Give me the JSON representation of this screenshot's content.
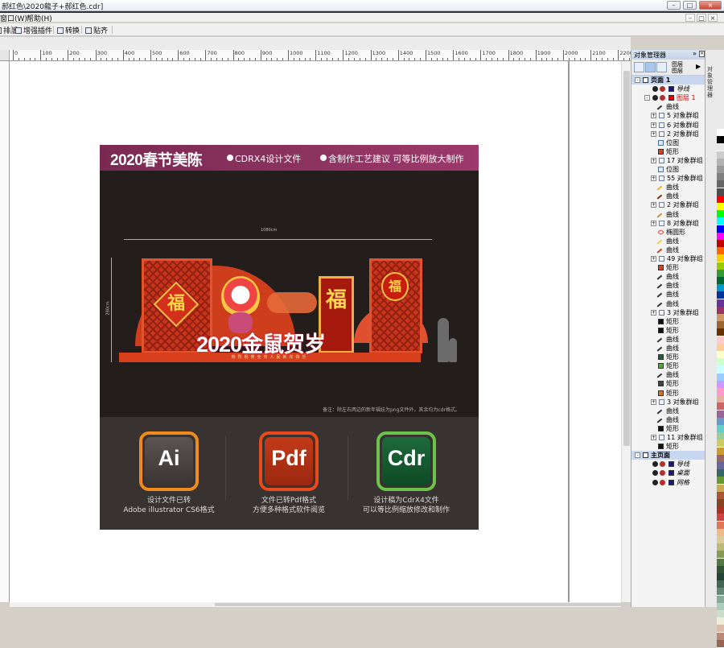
{
  "window": {
    "title": "郝红色\\2020龍子+郝红色.cdr]",
    "min": "–",
    "max": "□",
    "close": "×"
  },
  "menu": {
    "items": [
      "窗口(W)",
      "帮助(H)"
    ],
    "mdi": [
      "–",
      "□",
      "×"
    ]
  },
  "toolbar": {
    "items": [
      "排版",
      "增强插件",
      "转换",
      "贴齐"
    ]
  },
  "ruler": {
    "marks": [
      "0",
      "100",
      "200",
      "300",
      "400",
      "500",
      "600",
      "700",
      "800",
      "900",
      "1000",
      "1100",
      "1200",
      "1300",
      "1400",
      "1500",
      "1600",
      "1700",
      "1800",
      "1900",
      "2000",
      "2100",
      "2200"
    ],
    "unit": "毫米"
  },
  "design": {
    "header_big": "2020春节美陈",
    "header_sub1": "CDRX4设计文件",
    "header_sub2": "含制作工艺建议 可等比例放大制作",
    "dimension": "1080cm",
    "height_dim": "280cm",
    "fu1": "福",
    "fu2": "福",
    "fu3": "福",
    "slogan": "2020金鼠贺岁",
    "floor_text": "热烈祝贺全市人民新年快乐",
    "note": "备注：除左右两边的新年福娃为png文件外，其余均为cdr格式。",
    "formats": [
      {
        "label": "Ai",
        "cap1": "设计文件已转",
        "cap2": "Adobe illustrator CS6格式"
      },
      {
        "label": "Pdf",
        "cap1": "文件已转Pdf格式",
        "cap2": "方便多种格式软件阅览"
      },
      {
        "label": "Cdr",
        "cap1": "设计稿为CdrX4文件",
        "cap2": "可以等比例缩放修改和制作"
      }
    ]
  },
  "docker": {
    "title": "对象管理器",
    "tool_labels": [
      "图层",
      "图层"
    ],
    "side_tab": "对象管理器",
    "tree": [
      {
        "label": "页面 1",
        "level": 0,
        "exp": "-",
        "kind": "page",
        "bold": true
      },
      {
        "label": "导线",
        "level": 1,
        "kind": "layer-guide",
        "italic": true
      },
      {
        "label": "图层 1",
        "level": 1,
        "exp": "-",
        "kind": "layer",
        "red": true
      },
      {
        "label": "曲线",
        "level": 2,
        "kind": "curve"
      },
      {
        "label": "5 对象群组",
        "level": 2,
        "exp": "+",
        "kind": "group"
      },
      {
        "label": "6 对象群组",
        "level": 2,
        "exp": "+",
        "kind": "group"
      },
      {
        "label": "2 对象群组",
        "level": 2,
        "exp": "+",
        "kind": "group"
      },
      {
        "label": "位图",
        "level": 2,
        "kind": "bitmap"
      },
      {
        "label": "矩形",
        "level": 2,
        "kind": "rect",
        "color": "#e0401c"
      },
      {
        "label": "17 对象群组",
        "level": 2,
        "exp": "+",
        "kind": "group"
      },
      {
        "label": "位图",
        "level": 2,
        "kind": "bitmap"
      },
      {
        "label": "55 对象群组",
        "level": 2,
        "exp": "+",
        "kind": "group"
      },
      {
        "label": "曲线",
        "level": 2,
        "kind": "curve",
        "color": "#f0b020"
      },
      {
        "label": "曲线",
        "level": 2,
        "kind": "curve",
        "color": "#8a2a10"
      },
      {
        "label": "2 对象群组",
        "level": 2,
        "exp": "+",
        "kind": "group"
      },
      {
        "label": "曲线",
        "level": 2,
        "kind": "curve",
        "color": "#c89030"
      },
      {
        "label": "8 对象群组",
        "level": 2,
        "exp": "+",
        "kind": "group"
      },
      {
        "label": "椭圆形",
        "level": 2,
        "kind": "ellipse"
      },
      {
        "label": "曲线",
        "level": 2,
        "kind": "curve",
        "color": "#f0d040"
      },
      {
        "label": "曲线",
        "level": 2,
        "kind": "curve",
        "color": "#d04010"
      },
      {
        "label": "49 对象群组",
        "level": 2,
        "exp": "+",
        "kind": "group"
      },
      {
        "label": "矩形",
        "level": 2,
        "kind": "rect",
        "color": "#e0401c"
      },
      {
        "label": "曲线",
        "level": 2,
        "kind": "curve"
      },
      {
        "label": "曲线",
        "level": 2,
        "kind": "curve"
      },
      {
        "label": "曲线",
        "level": 2,
        "kind": "curve"
      },
      {
        "label": "曲线",
        "level": 2,
        "kind": "curve"
      },
      {
        "label": "3 对象群组",
        "level": 2,
        "exp": "+",
        "kind": "group"
      },
      {
        "label": "矩形",
        "level": 2,
        "kind": "rect",
        "color": "#111111"
      },
      {
        "label": "矩形",
        "level": 2,
        "kind": "rect",
        "color": "#111111"
      },
      {
        "label": "曲线",
        "level": 2,
        "kind": "curve"
      },
      {
        "label": "曲线",
        "level": 2,
        "kind": "curve"
      },
      {
        "label": "矩形",
        "level": 2,
        "kind": "rect",
        "color": "#116633"
      },
      {
        "label": "矩形",
        "level": 2,
        "kind": "rect",
        "color": "#55aa33"
      },
      {
        "label": "曲线",
        "level": 2,
        "kind": "curve"
      },
      {
        "label": "矩形",
        "level": 2,
        "kind": "rect",
        "color": "#444444"
      },
      {
        "label": "矩形",
        "level": 2,
        "kind": "rect",
        "color": "#e07010"
      },
      {
        "label": "3 对象群组",
        "level": 2,
        "exp": "+",
        "kind": "group"
      },
      {
        "label": "曲线",
        "level": 2,
        "kind": "curve"
      },
      {
        "label": "曲线",
        "level": 2,
        "kind": "curve"
      },
      {
        "label": "矩形",
        "level": 2,
        "kind": "rect",
        "color": "#111111"
      },
      {
        "label": "11 对象群组",
        "level": 2,
        "exp": "+",
        "kind": "group"
      },
      {
        "label": "矩形",
        "level": 2,
        "kind": "rect",
        "color": "#111111"
      },
      {
        "label": "主页面",
        "level": 0,
        "exp": "-",
        "kind": "page",
        "bold": true
      },
      {
        "label": "导线",
        "level": 1,
        "kind": "layer-guide",
        "italic": true
      },
      {
        "label": "桌面",
        "level": 1,
        "kind": "layer-desk",
        "italic": true
      },
      {
        "label": "网格",
        "level": 1,
        "kind": "layer-grid",
        "italic": true
      }
    ]
  },
  "palette": [
    "#ffffff",
    "#000000",
    "#e6e6e6",
    "#cccccc",
    "#b3b3b3",
    "#999999",
    "#808080",
    "#666666",
    "#4d4d4d",
    "#ff0000",
    "#ffff00",
    "#00ff00",
    "#00ffff",
    "#0000ff",
    "#ff00ff",
    "#c00000",
    "#ff6600",
    "#ffcc00",
    "#99cc00",
    "#339933",
    "#006633",
    "#0099cc",
    "#003399",
    "#663399",
    "#993366",
    "#cc9966",
    "#996633",
    "#663300",
    "#ffcccc",
    "#ffcc99",
    "#ffffcc",
    "#ccffcc",
    "#ccffff",
    "#99ccff",
    "#cc99ff",
    "#ff99cc",
    "#e6b0a0",
    "#cc6666",
    "#996699",
    "#6699cc",
    "#66cccc",
    "#99cc99",
    "#cccc66",
    "#cc9933",
    "#996666",
    "#666699",
    "#336666",
    "#669933",
    "#ccaa55",
    "#aa5533",
    "#884422",
    "#aa3322",
    "#cc4444",
    "#dd7755",
    "#eebb88",
    "#ddcc99",
    "#bbbb77",
    "#889955",
    "#557744",
    "#335533",
    "#224433",
    "#446655",
    "#668877",
    "#88aa99",
    "#aaccbb",
    "#ccddcc",
    "#eeeedd",
    "#ddbbaa",
    "#bb8877",
    "#996655"
  ]
}
